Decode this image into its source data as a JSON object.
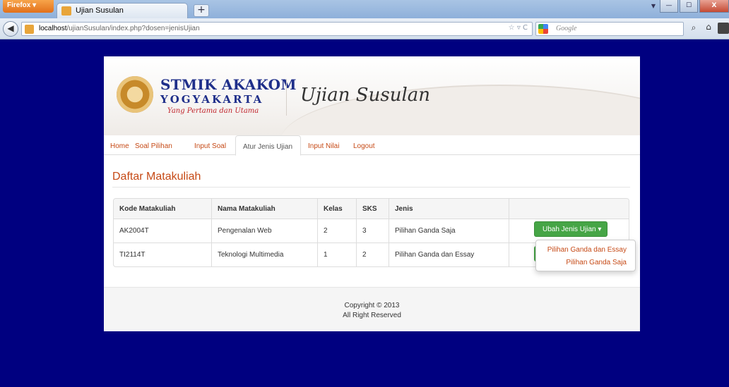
{
  "browser": {
    "menu_label": "Firefox",
    "tab_title": "Ujian Susulan",
    "new_tab": "+",
    "url_host": "localhost",
    "url_path": "/ujianSusulan/index.php?dosen=jenisUjian",
    "search_placeholder": "Google",
    "window_buttons": {
      "minimize": "—",
      "maximize": "☐",
      "close": "X"
    }
  },
  "header": {
    "logo_line1": "STMIK AKAKOM",
    "logo_line2": "YOGYAKARTA",
    "logo_tagline": "Yang Pertama dan Utama",
    "app_title": "Ujian Susulan"
  },
  "nav": {
    "items": [
      {
        "label": "Home"
      },
      {
        "label": "Soal Pilihan"
      },
      {
        "label": "Input Soal"
      },
      {
        "label": "Atur Jenis Ujian",
        "active": true
      },
      {
        "label": "Input Nilai"
      },
      {
        "label": "Logout"
      }
    ]
  },
  "main": {
    "title": "Daftar Matakuliah",
    "table": {
      "columns": [
        "Kode Matakuliah",
        "Nama Matakuliah",
        "Kelas",
        "SKS",
        "Jenis",
        ""
      ],
      "rows": [
        [
          "AK2004T",
          "Pengenalan Web",
          "2",
          "3",
          "Pilihan Ganda Saja"
        ],
        [
          "TI2114T",
          "Teknologi Multimedia",
          "1",
          "2",
          "Pilihan Ganda dan Essay"
        ]
      ]
    },
    "action_button": "Ubah Jenis Ujian",
    "dropdown": [
      "Pilihan Ganda dan Essay",
      "Pilihan Ganda Saja"
    ]
  },
  "footer": {
    "copyright": "Copyright © 2013",
    "rights": "All Right Reserved"
  },
  "colors": {
    "background": "#000080",
    "accent": "#c64a16",
    "button_green": "#46a546",
    "logo_blue": "#1f2f8a"
  }
}
